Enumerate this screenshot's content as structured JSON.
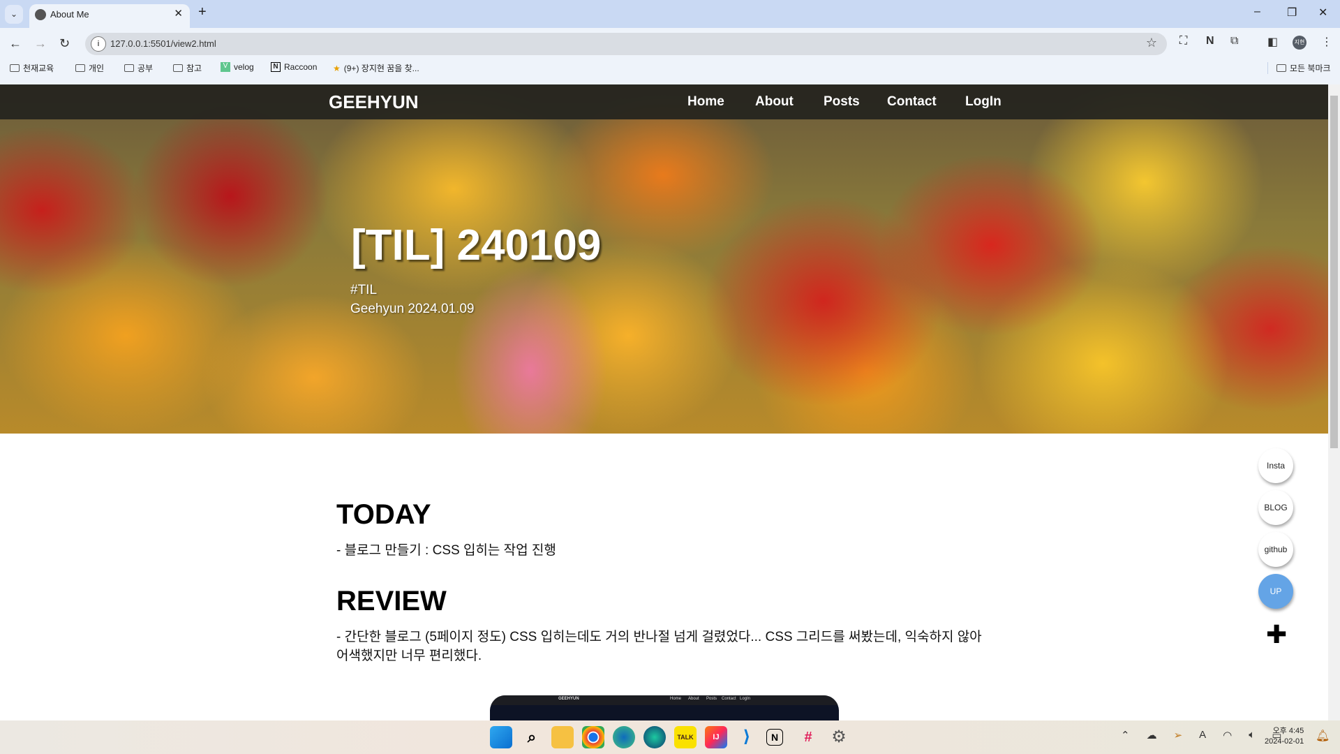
{
  "browser": {
    "tab_title": "About Me",
    "url": "127.0.0.1:5501/view2.html",
    "bookmarks": [
      {
        "label": "천재교육",
        "icon": "folder-icon"
      },
      {
        "label": "개인",
        "icon": "folder-icon"
      },
      {
        "label": "공부",
        "icon": "folder-icon"
      },
      {
        "label": "참고",
        "icon": "folder-icon"
      },
      {
        "label": "velog",
        "icon": "velog-icon"
      },
      {
        "label": "Raccoon",
        "icon": "notion-icon"
      },
      {
        "label": "(9+) 장지현 꿈을 찾...",
        "icon": "star-favicon"
      }
    ],
    "all_bookmarks": "모든 북마크",
    "profile_initials": "지현"
  },
  "site": {
    "logo": "GEEHYUN",
    "nav": [
      "Home",
      "About",
      "Posts",
      "Contact",
      "LogIn"
    ],
    "post": {
      "title": "[TIL] 240109",
      "tag": "#TIL",
      "meta": "Geehyun 2024.01.09"
    },
    "sections": [
      {
        "heading": "TODAY",
        "lines": [
          "- 블로그 만들기 : CSS 입히는 작업 진행"
        ]
      },
      {
        "heading": "REVIEW",
        "lines": [
          "- 간단한 블로그 (5페이지 정도) CSS 입히는데도 거의 반나절 넘게 걸렸었다... CSS 그리드를 써봤는데, 익숙하지 않아",
          "어색했지만 너무 편리했다."
        ]
      }
    ],
    "preview": {
      "logo": "GEEHYUN",
      "nav": [
        "Home",
        "About",
        "Posts",
        "Contact",
        "LogIn"
      ]
    },
    "floating": [
      "Insta",
      "BLOG",
      "github",
      "UP"
    ],
    "accent": "#64a4e6"
  },
  "taskbar": {
    "apps": [
      "start",
      "search",
      "file-explorer",
      "chrome",
      "edge",
      "whale",
      "kakaotalk",
      "intellij",
      "vscode",
      "notion",
      "slack",
      "settings"
    ],
    "time": "오후 4:45",
    "date": "2024-02-01"
  }
}
